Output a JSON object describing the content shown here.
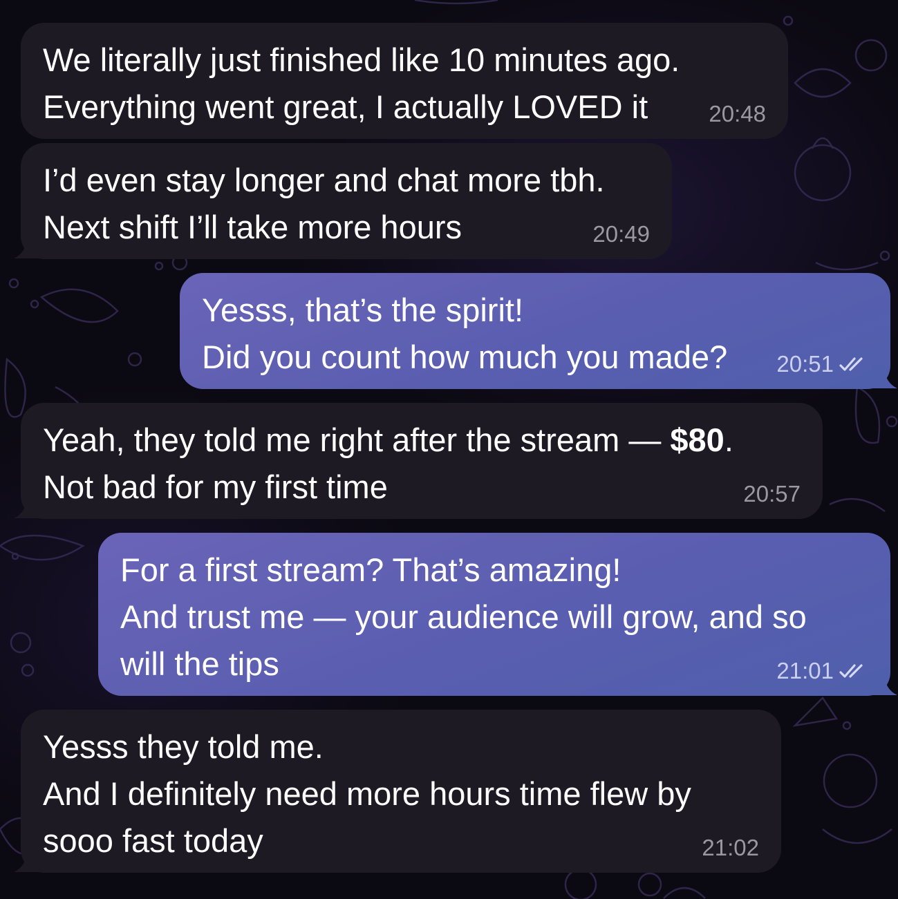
{
  "colors": {
    "incoming_bubble": "#1d1a24",
    "outgoing_bubble": "#5f62b4",
    "background": "#0b0911",
    "timestamp_incoming": "#9a98a2",
    "text": "#ffffff"
  },
  "messages": [
    {
      "direction": "incoming",
      "lines": [
        "We literally just finished like 10 minutes ago.",
        "Everything went great, I actually LOVED it"
      ],
      "time": "20:48"
    },
    {
      "direction": "incoming",
      "lines": [
        "I’d even stay longer and chat more tbh.",
        "Next shift I’ll take more hours"
      ],
      "time": "20:49"
    },
    {
      "direction": "outgoing",
      "lines": [
        "Yesss, that’s the spirit!",
        "Did you count how much you made?"
      ],
      "time": "20:51",
      "status_icon": "double-check-icon"
    },
    {
      "direction": "incoming",
      "lines": [
        "Yeah, they told me right after the stream — ",
        "Not bad for my first time"
      ],
      "emphasis": "$80",
      "emphasis_suffix": ".",
      "time": "20:57"
    },
    {
      "direction": "outgoing",
      "lines": [
        "For a first stream? That’s amazing!",
        "And trust me — your audience will grow, and so",
        "will the tips"
      ],
      "time": "21:01",
      "status_icon": "double-check-icon"
    },
    {
      "direction": "incoming",
      "lines": [
        "Yesss they told me.",
        "And I definitely need more hours time flew by",
        "sooo fast today"
      ],
      "time": "21:02"
    }
  ]
}
